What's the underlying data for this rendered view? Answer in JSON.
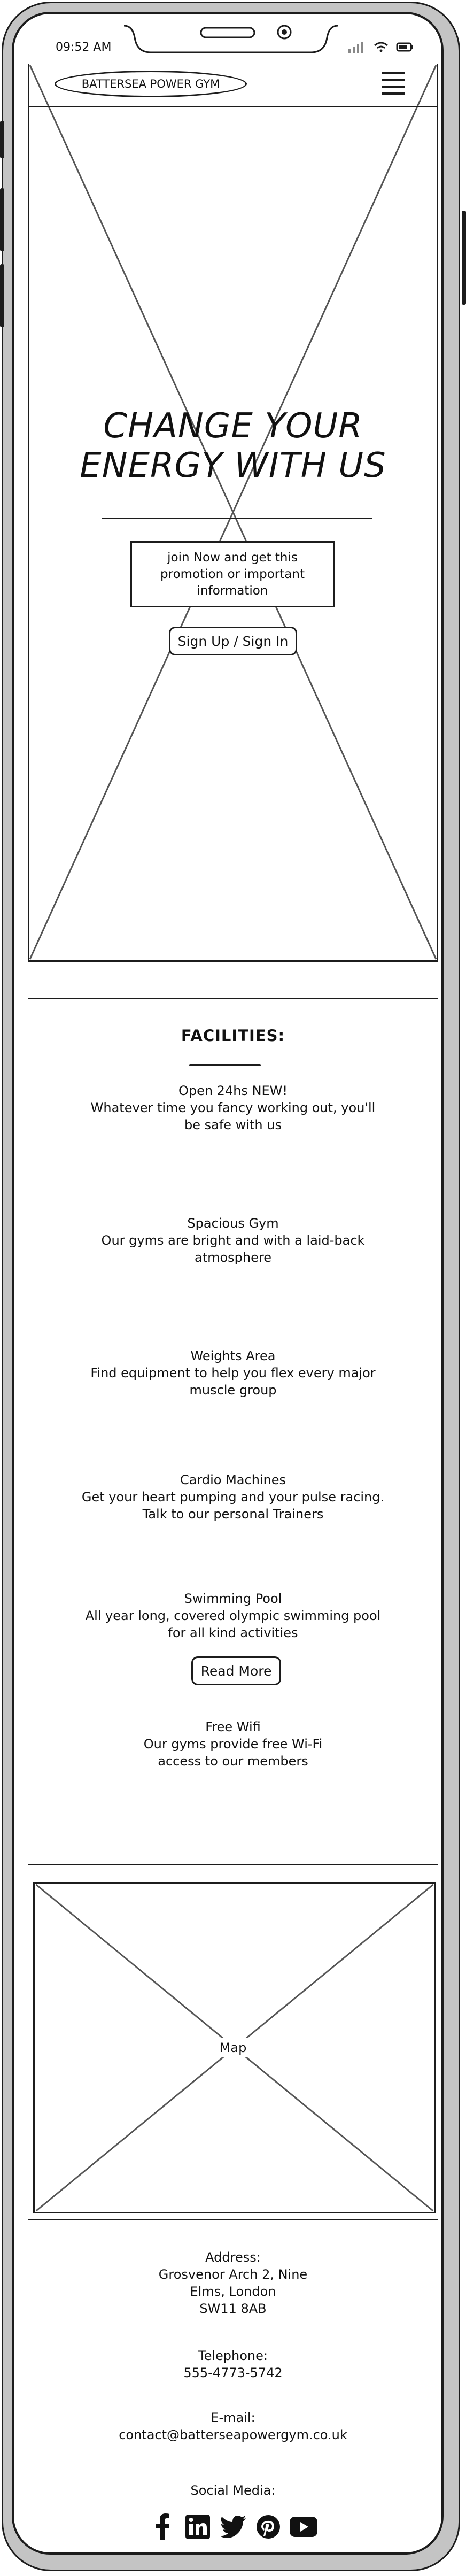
{
  "status_bar": {
    "time": "09:52 AM"
  },
  "header": {
    "logo_text": "BATTERSEA POWER GYM",
    "menu_icon": "hamburger-menu-icon"
  },
  "hero": {
    "title_line1": "CHANGE YOUR",
    "title_line2": "ENERGY WITH US",
    "promo_text": "join Now and get this promotion or important information",
    "cta_label": "Sign Up / Sign In"
  },
  "facilities": {
    "title": "FACILITIES:",
    "items": [
      {
        "title": "Open 24hs NEW!",
        "line1": "Whatever time you fancy working out, you'll",
        "line2": "be safe with us"
      },
      {
        "title": "Spacious Gym",
        "line1": "Our gyms are bright and with a laid-back",
        "line2": "atmosphere"
      },
      {
        "title": "Weights Area",
        "line1": "Find equipment to help you flex every major",
        "line2": "muscle group"
      },
      {
        "title": "Cardio Machines",
        "line1": "Get your heart pumping and your pulse racing.",
        "line2": "Talk to our personal Trainers"
      },
      {
        "title": "Swimming Pool",
        "line1": "All year long, covered olympic swimming pool",
        "line2": "for all kind activities"
      },
      {
        "title": "Free Wifi",
        "line1": "Our gyms provide free Wi-Fi",
        "line2": "access to our members"
      }
    ],
    "read_more_label": "Read More"
  },
  "map": {
    "label": "Map"
  },
  "footer": {
    "address_label": "Address:",
    "address_line1": "Grosvenor Arch 2, Nine",
    "address_line2": "Elms, London",
    "address_line3": "SW11 8AB",
    "telephone_label": "Telephone:",
    "telephone": "555-4773-5742",
    "email_label": "E-mail:",
    "email": "contact@batterseapowergym.co.uk",
    "social_label": "Social Media:",
    "social_icons": [
      "facebook-icon",
      "linkedin-icon",
      "twitter-icon",
      "pinterest-icon",
      "youtube-icon"
    ]
  }
}
